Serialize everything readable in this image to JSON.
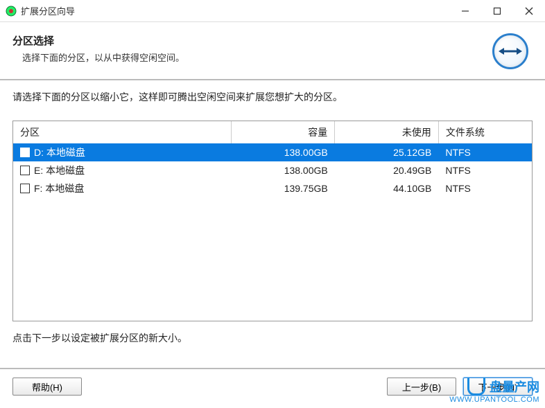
{
  "titlebar": {
    "title": "扩展分区向导"
  },
  "header": {
    "heading": "分区选择",
    "subheading": "选择下面的分区，以从中获得空闲空间。"
  },
  "instruction": "请选择下面的分区以缩小它，这样即可腾出空闲空间来扩展您想扩大的分区。",
  "table": {
    "headers": {
      "partition": "分区",
      "capacity": "容量",
      "unused": "未使用",
      "fs": "文件系统"
    },
    "rows": [
      {
        "checked": true,
        "selected": true,
        "name": "D: 本地磁盘",
        "capacity": "138.00GB",
        "unused": "25.12GB",
        "fs": "NTFS"
      },
      {
        "checked": false,
        "selected": false,
        "name": "E: 本地磁盘",
        "capacity": "138.00GB",
        "unused": "20.49GB",
        "fs": "NTFS"
      },
      {
        "checked": false,
        "selected": false,
        "name": "F: 本地磁盘",
        "capacity": "139.75GB",
        "unused": "44.10GB",
        "fs": "NTFS"
      }
    ]
  },
  "hint": "点击下一步以设定被扩展分区的新大小。",
  "buttons": {
    "help": "帮助(H)",
    "back": "上一步(B)",
    "next": "下一步(N)"
  },
  "watermark": {
    "brand": "盘量产网",
    "url": "WWW.UPANTOOL.COM"
  }
}
